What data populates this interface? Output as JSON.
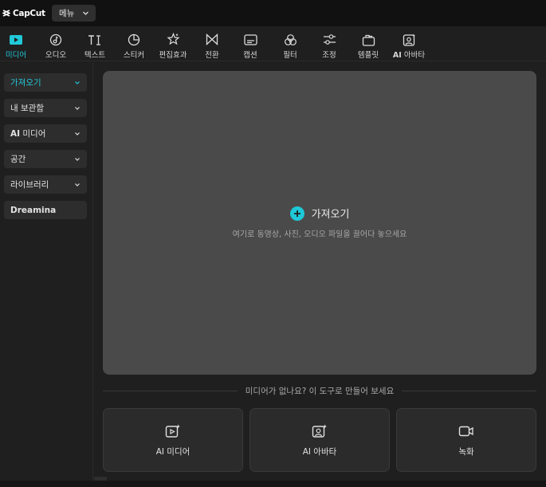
{
  "app": {
    "logo_text": "CapCut",
    "menu_label": "메뉴"
  },
  "toolbar": {
    "tools": [
      {
        "label": "미디어",
        "icon": "media-icon",
        "active": true
      },
      {
        "label": "오디오",
        "icon": "audio-icon"
      },
      {
        "label": "텍스트",
        "icon": "text-icon"
      },
      {
        "label": "스티커",
        "icon": "sticker-icon"
      },
      {
        "label": "편집효과",
        "icon": "effects-icon"
      },
      {
        "label": "전환",
        "icon": "transition-icon"
      },
      {
        "label": "캡션",
        "icon": "caption-icon"
      },
      {
        "label": "필터",
        "icon": "filter-icon"
      },
      {
        "label": "조정",
        "icon": "adjust-icon"
      },
      {
        "label": "템플릿",
        "icon": "template-icon"
      },
      {
        "label_prefix": "AI",
        "label": "아바타",
        "icon": "ai-avatar-icon"
      }
    ]
  },
  "sidebar": {
    "items": [
      {
        "label": "가져오기",
        "active": true
      },
      {
        "label": "내 보관함"
      },
      {
        "label_prefix": "AI",
        "label": "미디어"
      },
      {
        "label": "공간"
      },
      {
        "label": "라이브러리"
      },
      {
        "label": "Dreamina"
      }
    ]
  },
  "main": {
    "import_label": "가져오기",
    "import_hint": "여기로 동영상, 사진, 오디오 파일을 끌어다 놓으세요",
    "divider_text": "미디어가 없나요? 이 도구로 만들어 보세요",
    "cards": [
      {
        "label": "AI 미디어",
        "icon": "ai-media-icon"
      },
      {
        "label": "AI 아바타",
        "icon": "ai-avatar-icon"
      },
      {
        "label": "녹화",
        "icon": "record-icon"
      }
    ]
  },
  "colors": {
    "accent": "#1ec8d8",
    "panel": "#4a4a4a",
    "background": "#1f1f1f"
  }
}
